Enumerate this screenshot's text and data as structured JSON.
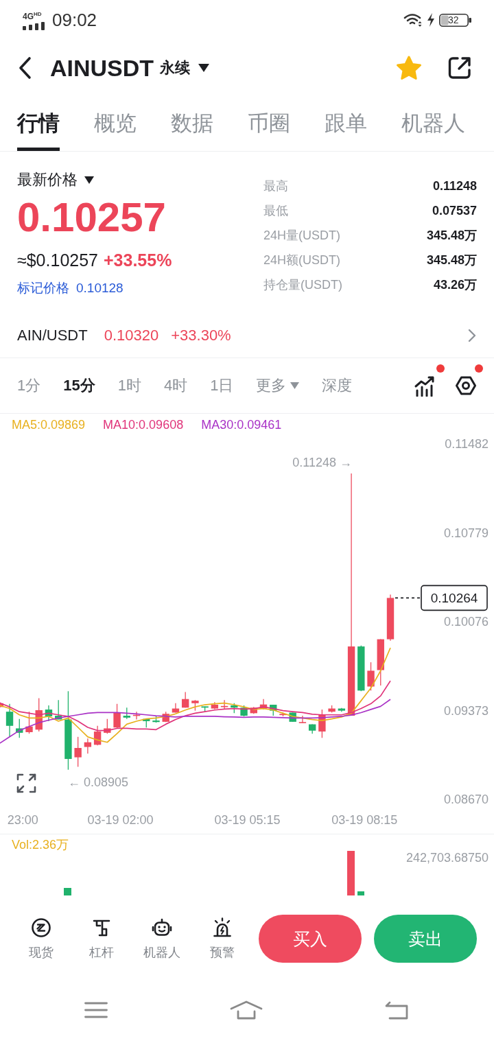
{
  "status_bar": {
    "network": "4G$^{HD}$",
    "time": "09:02",
    "battery": "32"
  },
  "header": {
    "symbol": "AINUSDT",
    "contract_type": "永续",
    "favorite": true
  },
  "tabs": [
    {
      "label": "行情",
      "selected": true
    },
    {
      "label": "概览",
      "selected": false
    },
    {
      "label": "数据",
      "selected": false
    },
    {
      "label": "币圈",
      "selected": false
    },
    {
      "label": "跟单",
      "selected": false
    },
    {
      "label": "机器人",
      "selected": false
    }
  ],
  "price_panel": {
    "label": "最新价格",
    "last_price": "0.10257",
    "usd_price": "≈$0.10257",
    "change": "+33.55%",
    "mark_price_label": "标记价格",
    "mark_price": "0.10128",
    "stats": [
      {
        "label": "最高",
        "value": "0.11248"
      },
      {
        "label": "最低",
        "value": "0.07537"
      },
      {
        "label": "24H量(USDT)",
        "value": "345.48万"
      },
      {
        "label": "24H额(USDT)",
        "value": "345.48万"
      },
      {
        "label": "持仓量(USDT)",
        "value": "43.26万"
      }
    ]
  },
  "spot_row": {
    "pair": "AIN/USDT",
    "price": "0.10320",
    "change": "+33.30%"
  },
  "intervals": [
    {
      "label": "1分",
      "selected": false,
      "dropdown": false
    },
    {
      "label": "15分",
      "selected": true,
      "dropdown": false
    },
    {
      "label": "1时",
      "selected": false,
      "dropdown": false
    },
    {
      "label": "4时",
      "selected": false,
      "dropdown": false
    },
    {
      "label": "1日",
      "selected": false,
      "dropdown": false
    },
    {
      "label": "更多",
      "selected": false,
      "dropdown": true
    },
    {
      "label": "深度",
      "selected": false,
      "dropdown": false
    }
  ],
  "chart_tools": [
    {
      "kind": "indicators",
      "badge": true
    },
    {
      "kind": "settings",
      "badge": true
    }
  ],
  "price_chart": {
    "chart_data": {
      "type": "candlestick",
      "categories": [
        null,
        null,
        "23:00",
        null,
        null,
        null,
        null,
        null,
        null,
        null,
        null,
        null,
        "03-19 02:00",
        null,
        null,
        null,
        null,
        null,
        null,
        null,
        null,
        null,
        null,
        null,
        null,
        "03-19 05:15",
        null,
        null,
        null,
        null,
        null,
        null,
        null,
        null,
        null,
        null,
        null,
        "03-19 08:15",
        null,
        null,
        null
      ],
      "ohlc": [
        [
          0.09401,
          0.09439,
          0.09396,
          0.09431
        ],
        [
          0.09364,
          0.09426,
          0.09165,
          0.09252
        ],
        [
          0.09232,
          0.09307,
          0.09157,
          0.09197
        ],
        [
          0.09202,
          0.09364,
          0.0919,
          0.09247
        ],
        [
          0.09222,
          0.09471,
          0.09207,
          0.09376
        ],
        [
          0.09381,
          0.09414,
          0.09289,
          0.09327
        ],
        [
          0.09332,
          0.09456,
          0.09302,
          0.09302
        ],
        [
          0.09302,
          0.09526,
          0.08905,
          0.0899
        ],
        [
          0.09003,
          0.09165,
          0.08928,
          0.09077
        ],
        [
          0.09085,
          0.09152,
          0.09032,
          0.09122
        ],
        [
          0.09102,
          0.09252,
          0.09097,
          0.09207
        ],
        [
          0.09197,
          0.09307,
          0.0919,
          0.09232
        ],
        [
          0.09239,
          0.09426,
          0.09232,
          0.09357
        ],
        [
          0.09332,
          0.09396,
          0.09307,
          0.09317
        ],
        [
          0.09332,
          0.09364,
          0.09302,
          0.09339
        ],
        [
          0.09307,
          0.09307,
          0.09239,
          0.09289
        ],
        [
          0.09294,
          0.09327,
          0.09277,
          0.09282
        ],
        [
          0.09284,
          0.09364,
          0.09282,
          0.09347
        ],
        [
          0.09357,
          0.09431,
          0.09357,
          0.09389
        ],
        [
          0.09396,
          0.09519,
          0.09396,
          0.09464
        ],
        [
          0.09431,
          0.09456,
          0.09372,
          0.09451
        ],
        [
          0.09406,
          0.09406,
          0.09364,
          0.09396
        ],
        [
          0.09389,
          0.09439,
          0.09384,
          0.09419
        ],
        [
          0.09401,
          0.09456,
          0.09381,
          0.09409
        ],
        [
          0.09414,
          0.09431,
          0.09352,
          0.09396
        ],
        [
          0.09396,
          0.09414,
          0.09327,
          0.09332
        ],
        [
          0.09352,
          0.09401,
          0.09347,
          0.09396
        ],
        [
          0.09389,
          0.09464,
          0.09381,
          0.09421
        ],
        [
          0.09419,
          0.09419,
          0.09332,
          0.09372
        ],
        [
          0.09337,
          0.09357,
          0.09327,
          0.09347
        ],
        [
          0.09357,
          0.09357,
          0.09284,
          0.09284
        ],
        [
          0.09274,
          0.09332,
          0.09274,
          0.09282
        ],
        [
          0.09264,
          0.09264,
          0.0919,
          0.09214
        ],
        [
          0.09207,
          0.09381,
          0.09157,
          0.09339
        ],
        [
          0.09364,
          0.09414,
          0.09357,
          0.09389
        ],
        [
          0.09389,
          0.09394,
          0.09364,
          0.09372
        ],
        [
          0.09332,
          0.11248,
          0.09332,
          0.0988
        ],
        [
          0.0988,
          0.09887,
          0.09526,
          0.09531
        ],
        [
          0.09563,
          0.09755,
          0.09531,
          0.09688
        ],
        [
          0.09693,
          0.09937,
          0.09571,
          0.09937
        ],
        [
          0.09937,
          0.1029,
          0.09925,
          0.10264
        ]
      ],
      "series": [
        {
          "name": "MA5:0.09869",
          "type": "line",
          "color": "#e8b01e",
          "values": [
            0.09414,
            0.09389,
            0.09339,
            0.09314,
            0.09314,
            0.09327,
            0.09289,
            0.09314,
            0.0924,
            0.09165,
            0.0914,
            0.09122,
            0.0919,
            0.09265,
            0.09289,
            0.09307,
            0.09314,
            0.09327,
            0.09347,
            0.09377,
            0.09402,
            0.09419,
            0.09427,
            0.09432,
            0.09419,
            0.09402,
            0.09382,
            0.09389,
            0.09377,
            0.09352,
            0.09327,
            0.09314,
            0.09302,
            0.09294,
            0.09307,
            0.09322,
            0.09352,
            0.09451,
            0.09551,
            0.09688,
            0.09869
          ]
        },
        {
          "name": "MA10:0.09608",
          "type": "line",
          "color": "#e0347a",
          "values": [
            0.09432,
            0.09402,
            0.09364,
            0.09352,
            0.09339,
            0.09352,
            0.09339,
            0.09327,
            0.09289,
            0.0924,
            0.09215,
            0.09215,
            0.09232,
            0.09232,
            0.09227,
            0.09227,
            0.09222,
            0.09265,
            0.09302,
            0.09332,
            0.09352,
            0.09364,
            0.09377,
            0.09384,
            0.09389,
            0.09384,
            0.09387,
            0.09402,
            0.09389,
            0.09372,
            0.09364,
            0.09357,
            0.09344,
            0.09339,
            0.09339,
            0.09339,
            0.09357,
            0.09389,
            0.09427,
            0.09489,
            0.09608
          ]
        },
        {
          "name": "MA30:0.09461",
          "type": "line",
          "color": "#a932c6",
          "values": [
            0.09115,
            0.09165,
            0.09215,
            0.09247,
            0.09277,
            0.09297,
            0.09314,
            0.09327,
            0.09339,
            0.09352,
            0.09357,
            0.09357,
            0.09357,
            0.09352,
            0.09347,
            0.09339,
            0.09332,
            0.09327,
            0.09322,
            0.09327,
            0.09327,
            0.09327,
            0.09327,
            0.09324,
            0.09322,
            0.09319,
            0.09322,
            0.09322,
            0.09319,
            0.09317,
            0.09314,
            0.09314,
            0.09314,
            0.09317,
            0.09322,
            0.09327,
            0.09337,
            0.09357,
            0.09382,
            0.09406,
            0.09461
          ]
        }
      ],
      "ylim": [
        0.0867,
        0.11482
      ],
      "yticks": [
        {
          "value": 0.11482,
          "label": "0.11482"
        },
        {
          "value": 0.10779,
          "label": "0.10779"
        },
        {
          "value": 0.10076,
          "label": "0.10076"
        },
        {
          "value": 0.09373,
          "label": "0.09373"
        },
        {
          "value": 0.0867,
          "label": "0.08670"
        }
      ]
    },
    "high_marker": "0.11248 →",
    "low_marker": "← 0.08905",
    "last_price_tag": "0.10264"
  },
  "volume": {
    "label": "Vol:2.36万",
    "max_label": "242,703.68750"
  },
  "action_bar": {
    "shortcuts": [
      {
        "kind": "spot",
        "label": "现货"
      },
      {
        "kind": "leverage",
        "label": "杠杆"
      },
      {
        "kind": "robot",
        "label": "机器人"
      },
      {
        "kind": "alert",
        "label": "预警"
      }
    ],
    "buy_label": "买入",
    "sell_label": "卖出"
  }
}
